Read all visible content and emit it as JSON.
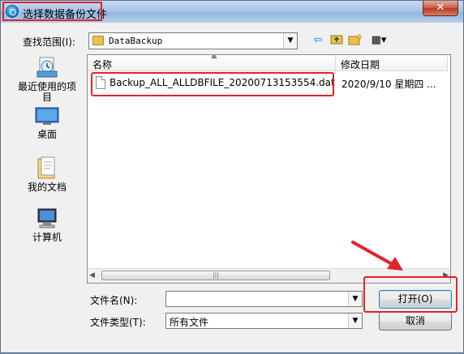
{
  "window": {
    "title": "选择数据备份文件",
    "close_glyph": "✕"
  },
  "lookin": {
    "label": "查找范围(I):",
    "value": "DataBackup"
  },
  "toolbar": {
    "back_icon": "⇦",
    "up_icon": "up-folder",
    "new_folder_icon": "new-folder",
    "view_icon": "▦▾"
  },
  "places": [
    {
      "label": "最近使用的项目",
      "icon": "recent-icon"
    },
    {
      "label": "桌面",
      "icon": "desktop-icon"
    },
    {
      "label": "我的文档",
      "icon": "documents-icon"
    },
    {
      "label": "计算机",
      "icon": "computer-icon"
    }
  ],
  "filelist": {
    "columns": [
      "名称",
      "修改日期"
    ],
    "files": [
      {
        "name": "Backup_ALL_ALLDBFILE_20200713153554.dat",
        "date": "2020/9/10 星期四 ..."
      }
    ]
  },
  "filename": {
    "label": "文件名(N):",
    "value": ""
  },
  "filetype": {
    "label": "文件类型(T):",
    "value": "所有文件"
  },
  "buttons": {
    "open": "打开(O)",
    "cancel": "取消"
  },
  "colors": {
    "highlight": "#e0242a"
  }
}
